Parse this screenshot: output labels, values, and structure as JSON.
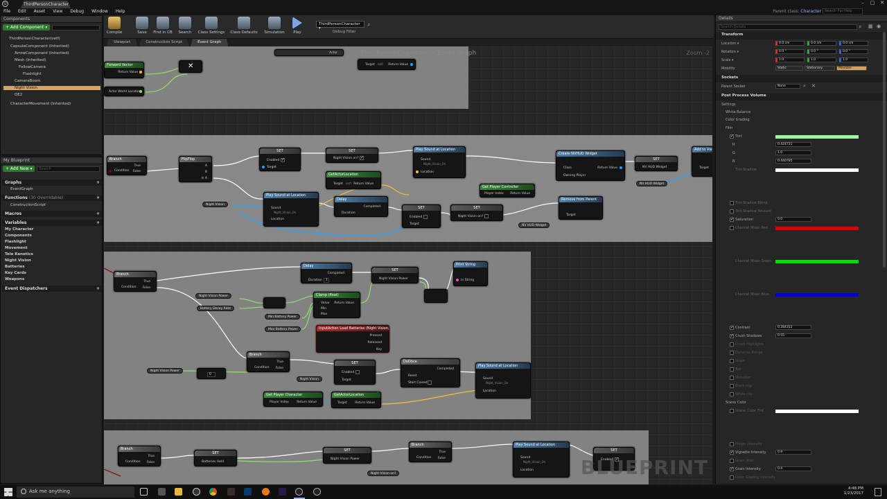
{
  "window": {
    "tab_title": "ThirdPersonCharacter",
    "parent_class_label": "Parent class:",
    "parent_class_value": "Character",
    "help_placeholder": "Search For Help"
  },
  "menu": [
    "File",
    "Edit",
    "Asset",
    "View",
    "Debug",
    "Window",
    "Help"
  ],
  "components": {
    "tab": "Components",
    "add_button": "+ Add Component ▾",
    "items": [
      "ThirdPersonCharacter(self)",
      "CapsuleComponent (Inherited)",
      "ArrowComponent (Inherited)",
      "Mesh (Inherited)",
      "FollowCamera",
      "Flashlight",
      "CameraBoom",
      "Night Vision",
      "DE2",
      "CharacterMovement (Inherited)"
    ],
    "selected": "Night Vision"
  },
  "my_blueprint": {
    "tab": "My Blueprint",
    "add_button": "+ Add New ▾",
    "search_placeholder": "Search",
    "sections": {
      "graphs": "Graphs",
      "event_graph": "EventGraph",
      "functions": "Functions",
      "functions_count": "(30 Overridable)",
      "construction": "ConstructionScript",
      "macros": "Macros",
      "variables": "Variables",
      "dispatchers": "Event Dispatchers"
    },
    "variable_groups": [
      "My Character",
      "Components",
      "Flashlight",
      "Movement",
      "Tele Kenetics",
      "Night Vision",
      "Batteries",
      "Key Cards",
      "Weapons"
    ]
  },
  "toolbar": {
    "compile": "Compile",
    "save": "Save",
    "find_in_cb": "Find in CB",
    "search": "Search",
    "class_settings": "Class Settings",
    "class_defaults": "Class Defaults",
    "simulation": "Simulation",
    "play": "Play",
    "debug_object": "ThirdPersonCharacter ▾",
    "debug_filter": "Debug Filter"
  },
  "graph_tabs": [
    "Viewport",
    "Construction Script",
    "Event Graph"
  ],
  "graph": {
    "breadcrumb_root": "ThirdPersonCharacter",
    "breadcrumb_sep": ">",
    "breadcrumb_leaf": "Event Graph",
    "zoom": "Zoom -2",
    "watermark": "BLUEPRINT",
    "top_labels": [
      "Forward Vector",
      "Return Value",
      "Actor World Location",
      "Target",
      "self",
      "Return Value",
      "Actor"
    ]
  },
  "nodes": {
    "branch": "Branch",
    "condition": "Condition",
    "true": "True",
    "false": "False",
    "flipflop": "FlipFlop",
    "a": "A",
    "b": "B",
    "is_a": "Is A",
    "set": "SET",
    "enabled": "Enabled",
    "target": "Target",
    "night_vision_on": "Night Vision on?",
    "play_sound": "Play Sound at Location",
    "sound": "Sound",
    "location": "Location",
    "sound_asset": "Night_Vision_On",
    "get_actor_location": "GetActorLocation",
    "return_value": "Return Value",
    "self": "self",
    "delay": "Delay",
    "duration": "Duration",
    "completed": "Completed",
    "create_widget": "Create NVHUD Widget",
    "class": "Class",
    "owning_player": "Owning Player",
    "nv_hud_widget": "NV HUD Widget",
    "get_player_controller": "Get Player Controller",
    "player_index": "Player Index",
    "remove_from_parent": "Remove from Parent",
    "night_vision": "Night Vision",
    "add_to_viewport": "Add to Viewport",
    "night_vision_power": "Night Vision Power",
    "battery_decay_rate": "Battery Decay Rate",
    "clamp": "Clamp (float)",
    "value": "Value",
    "min": "Min",
    "max": "Max",
    "min_battery_power": "Min Battery Power",
    "max_battery_power": "Max Battery Power",
    "print_string": "Print String",
    "in_string": "In String",
    "input_action": "InputAction Load Batteries (Night Vision)",
    "pressed": "Pressed",
    "released": "Released",
    "key": "Key",
    "doonce": "DoOnce",
    "reset": "Reset",
    "start_closed": "Start Closed",
    "get_player_character": "Get Player Character",
    "batteries_held": "Batteries Held",
    "duration_val": "1",
    "zero": "0"
  },
  "details": {
    "tab": "Details",
    "search_placeholder": "Search Details",
    "transform": "Transform",
    "location": "Location ▾",
    "rotation": "Rotation ▾",
    "scale": "Scale ▾",
    "mobility": "Mobility",
    "loc_vals": [
      "0.0 cm",
      "0.0 cm",
      "0.0 cm"
    ],
    "rot_vals": [
      "0.0 °",
      "0.0 °",
      "0.0 °"
    ],
    "scale_vals": [
      "1.0",
      "1.0",
      "1.0"
    ],
    "mobility_opts": [
      "Static",
      "Stationary",
      "Movable"
    ],
    "sockets": "Sockets",
    "parent_socket": "Parent Socket",
    "parent_socket_val": "None",
    "ppv": "Post Process Volume",
    "settings": "Settings",
    "white_balance": "White Balance",
    "color_grading": "Color Grading",
    "film": "Film",
    "tint": "Tint",
    "r": "R",
    "g": "G",
    "b": "B",
    "tint_vals": [
      "0.424721",
      "1.0",
      "0.440785"
    ],
    "tint_shadow": "Tint Shadow",
    "tint_shadow_blend": "Tint Shadow Blend",
    "tint_shadow_amount": "Tint Shadow Amount",
    "saturation": "Saturation",
    "saturation_val": "0.0",
    "mixer_red": "Channel Mixer Red",
    "mixer_green": "Channel Mixer Green",
    "mixer_blue": "Channel Mixer Blue",
    "contrast": "Contrast",
    "contrast_val": "0.284312",
    "crush_shadows": "Crush Shadows",
    "crush_val": "0.55",
    "crush_highlights": "Crush Highlights",
    "dynamic_range": "Dynamic Range",
    "slope": "Slope",
    "toe": "Toe",
    "shoulder": "Shoulder",
    "black_clip": "Black clip",
    "white_clip": "White clip",
    "scene_color": "Scene Color",
    "scene_color_tint": "Scene Color Tint",
    "fringe": "Fringe Intensity",
    "vignette": "Vignette Intensity",
    "vignette_val": "0.9",
    "grain_jitter": "Grain Jitter",
    "grain_intensity": "Grain Intensity",
    "grain_val": "0.4",
    "color_grading_intensity": "Color Grading Intensity",
    "colors": {
      "tint": "#9cf7a2",
      "red": "#e00000",
      "green": "#00e000",
      "blue": "#0000d8",
      "white": "#ffffff"
    }
  },
  "taskbar": {
    "search": "Ask me anything",
    "time": "4:48 PM",
    "date": "1/23/2017"
  },
  "colors": {
    "exec_pin": "#ffffff",
    "bool_pin": "#8a0000",
    "float_pin": "#8ee36b",
    "object_pin": "#1ea4ff",
    "vector_pin": "#f2c230"
  }
}
